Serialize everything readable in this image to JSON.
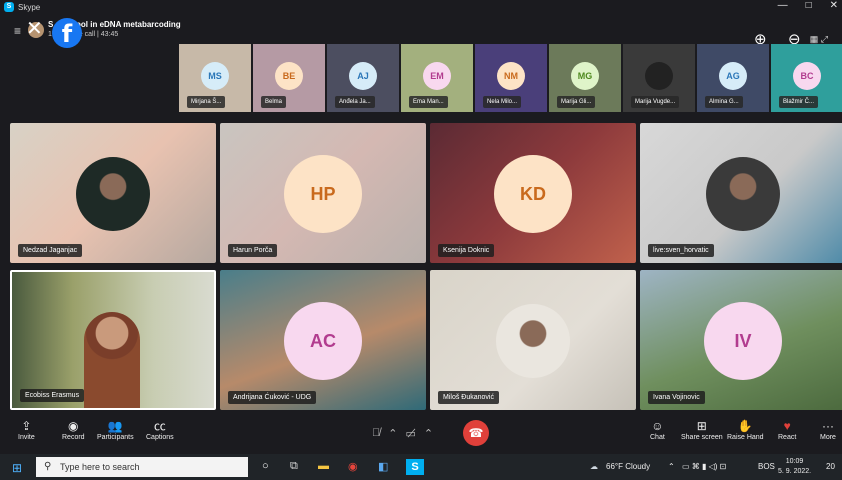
{
  "window": {
    "app_name": "Skype",
    "controls": [
      "—",
      "□",
      "✕"
    ]
  },
  "call": {
    "title": "Summer school in eDNA metabarcoding",
    "title_visible": "S... school in eDNA metabarcoding",
    "subtitle": "17 ... in the call | 43:45"
  },
  "strip": [
    {
      "initials": "MS",
      "name": "Mirjana Š...",
      "bg": "#c7b9a8",
      "avbg": "#d6ecf8",
      "avfg": "#2b77b8"
    },
    {
      "initials": "BE",
      "name": "Belma",
      "bg": "#b59aa4",
      "avbg": "#fde3c6",
      "avfg": "#c96a1d"
    },
    {
      "initials": "AJ",
      "name": "Anđela Ja...",
      "bg": "#4c4e60",
      "avbg": "#d6ecf8",
      "avfg": "#2b77b8"
    },
    {
      "initials": "EM",
      "name": "Ema Man...",
      "bg": "#a3b07e",
      "avbg": "#f8d8ef",
      "avfg": "#b23c8f"
    },
    {
      "initials": "NM",
      "name": "Nela Milo...",
      "bg": "#4a3f7a",
      "avbg": "#fde3c6",
      "avfg": "#c96a1d"
    },
    {
      "initials": "MG",
      "name": "Marija Gli...",
      "bg": "#6c7a5a",
      "avbg": "#dff4c9",
      "avfg": "#4f8a1f"
    },
    {
      "initials": "",
      "name": "Marija Vugde...",
      "bg": "#3a3a3a",
      "avbg": "#222",
      "avfg": "#fff"
    },
    {
      "initials": "AG",
      "name": "Almina G...",
      "bg": "#3f4a66",
      "avbg": "#d6ecf8",
      "avfg": "#2b77b8"
    },
    {
      "initials": "BC",
      "name": "Blažmir Č...",
      "bg": "#2f9f9c",
      "avbg": "#f8d8ef",
      "avfg": "#b23c8f"
    }
  ],
  "tiles": [
    {
      "name": "Nedzad Jaganjac",
      "initials": "",
      "bg": "linear-gradient(135deg,#d8d2c6,#e8c2b0 50%,#b5a8a0)",
      "avbg": "",
      "avfg": "",
      "photo": "#1e2a26"
    },
    {
      "name": "Harun Porča",
      "initials": "HP",
      "bg": "linear-gradient(135deg,#c9c5c0,#d4b8b2 50%,#b8b0ac)",
      "avbg": "#fde3c6",
      "avfg": "#c96a1d",
      "photo": ""
    },
    {
      "name": "Ksenija Doknic",
      "initials": "KD",
      "bg": "linear-gradient(135deg,#5b2a34,#8d3a3c 50%,#c0614c)",
      "avbg": "#fde3c6",
      "avfg": "#c96a1d",
      "photo": ""
    },
    {
      "name": "live:sven_horvatic",
      "initials": "",
      "bg": "linear-gradient(135deg,#d8d8d8,#c9c9c9 55%,#4d8aa8)",
      "avbg": "",
      "avfg": "",
      "photo": "#3a3a3a"
    },
    {
      "name": "Ecobiss Erasmus",
      "initials": "",
      "bg": "linear-gradient(90deg,#4a5a3e,#9aa06a 30%,#c8cdb2 70%,#d9dbd0)",
      "avbg": "",
      "avfg": "",
      "photo": ""
    },
    {
      "name": "Andrijana Ćuković - UDG",
      "initials": "AC",
      "bg": "linear-gradient(160deg,#4a7e8a,#b78a6a 55%,#2f6a78)",
      "avbg": "#f8d8ef",
      "avfg": "#b23c8f",
      "photo": ""
    },
    {
      "name": "Miloš Đukanović",
      "initials": "",
      "bg": "linear-gradient(135deg,#d9d4c9,#e3ded6 60%,#c6c1b8)",
      "avbg": "",
      "avfg": "",
      "photo": "#eae6df"
    },
    {
      "name": "Ivana Vojinovic",
      "initials": "IV",
      "bg": "linear-gradient(160deg,#9eb4c4,#6f8f5e 55%,#4c6a3e)",
      "avbg": "#f8d8ef",
      "avfg": "#b23c8f",
      "photo": ""
    }
  ],
  "controls": {
    "invite": "Invite",
    "record": "Record",
    "participants": "Participants",
    "captions": "Captions",
    "chat": "Chat",
    "share": "Share screen",
    "raise": "Raise Hand",
    "react": "React",
    "more": "More"
  },
  "taskbar": {
    "search_placeholder": "Type here to search",
    "weather": "66°F  Cloudy",
    "lang": "BOS",
    "time": "10:09",
    "date": "5. 9. 2022.",
    "notif_count": "20"
  },
  "colors": {
    "hangup": "#e0403a",
    "skype": "#00aff0",
    "facebook": "#1877f2"
  }
}
